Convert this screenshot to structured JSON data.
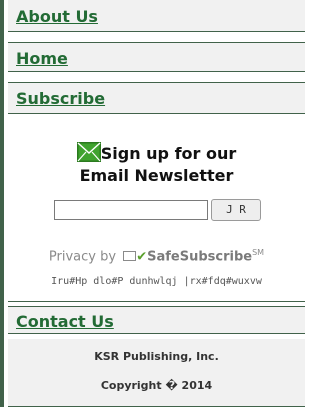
{
  "nav": {
    "about": "About Us",
    "home": "Home",
    "subscribe": "Subscribe",
    "contact": "Contact Us"
  },
  "newsletter": {
    "title_line1": "Sign up for our",
    "title_line2": "Email Newsletter",
    "input_value": "",
    "go_label": "J R",
    "privacy_prefix": "Privacy by",
    "safesubscribe": "SafeSubscribe",
    "sm": "SM",
    "cipher_text": "Iru#Hp dlo#P dunhwlqj |rx#fdq#wuxvw"
  },
  "footer": {
    "company": "KSR Publishing, Inc.",
    "copyright": "Copyright � 2014"
  },
  "colors": {
    "brand_green": "#236b35",
    "border_green": "#41624a",
    "nav_bg": "#f1f1f1"
  }
}
